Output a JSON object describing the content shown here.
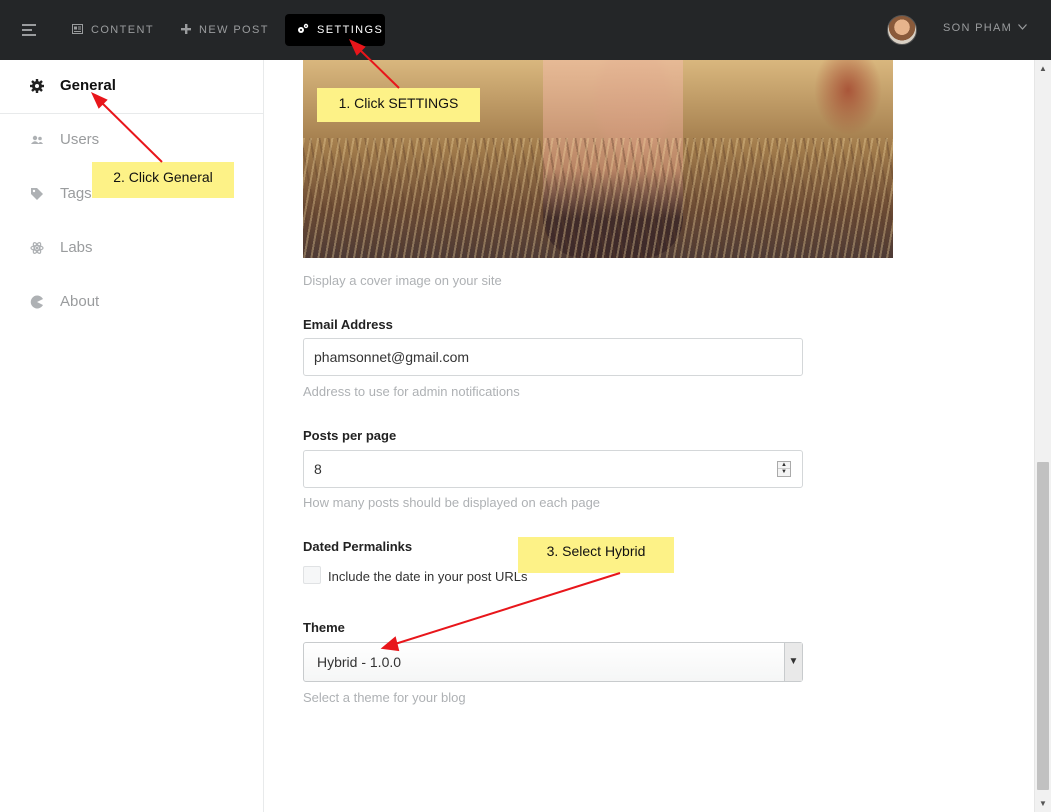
{
  "topbar": {
    "menu_icon": "hamburger-icon",
    "nav": [
      {
        "label": "CONTENT",
        "icon": "content-icon"
      },
      {
        "label": "NEW POST",
        "icon": "plus-icon"
      },
      {
        "label": "SETTINGS",
        "icon": "gears-icon"
      }
    ],
    "user": {
      "name": "SON PHAM",
      "icon": "chevron-down-icon"
    }
  },
  "sidebar": {
    "items": [
      {
        "label": "General",
        "icon": "gear-icon",
        "active": true
      },
      {
        "label": "Users",
        "icon": "users-icon"
      },
      {
        "label": "Tags",
        "icon": "tag-icon"
      },
      {
        "label": "Labs",
        "icon": "atom-icon"
      },
      {
        "label": "About",
        "icon": "pie-icon"
      }
    ]
  },
  "main": {
    "cover_help": "Display a cover image on your site",
    "email": {
      "label": "Email Address",
      "value": "phamsonnet@gmail.com",
      "help": "Address to use for admin notifications"
    },
    "posts_per_page": {
      "label": "Posts per page",
      "value": "8",
      "help": "How many posts should be displayed on each page"
    },
    "permalinks": {
      "label": "Dated Permalinks",
      "checkbox_label": "Include the date in your post URLs",
      "checked": false
    },
    "theme": {
      "label": "Theme",
      "value": "Hybrid - 1.0.0",
      "help": "Select a theme for your blog"
    }
  },
  "annotations": {
    "step1": "1. Click SETTINGS",
    "step2": "2. Click General",
    "step3": "3. Select Hybrid"
  },
  "colors": {
    "topbar_bg": "#242628",
    "active_nav_bg": "#000000",
    "callout_bg": "#fdf287",
    "arrow": "#e8161b"
  }
}
